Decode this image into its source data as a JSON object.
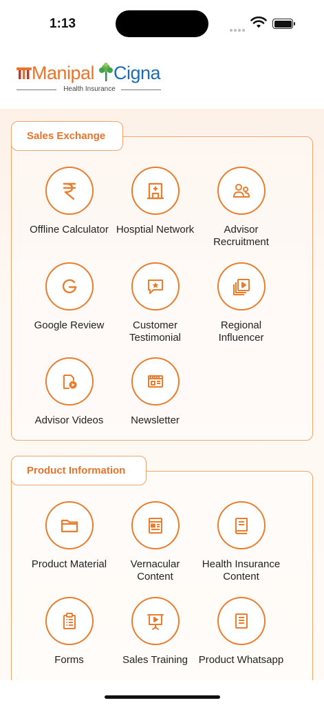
{
  "status_bar": {
    "time": "1:13"
  },
  "header": {
    "brand_part1": "Manipal",
    "brand_part2": "Cigna",
    "tagline": "Health Insurance"
  },
  "colors": {
    "accent": "#E8742B",
    "brand_blue": "#1F6BB0",
    "border": "#F0A56A"
  },
  "sections": [
    {
      "title": "Sales Exchange",
      "items": [
        {
          "label": "Offline Calculator",
          "icon": "rupee-icon"
        },
        {
          "label": "Hosptial Network",
          "icon": "hospital-icon"
        },
        {
          "label": "Advisor Recruitment",
          "icon": "users-icon"
        },
        {
          "label": "Google Review",
          "icon": "google-icon"
        },
        {
          "label": "Customer Testimonial",
          "icon": "star-message-icon"
        },
        {
          "label": "Regional Influencer",
          "icon": "video-library-icon"
        },
        {
          "label": "Advisor Videos",
          "icon": "video-file-icon"
        },
        {
          "label": "Newsletter",
          "icon": "newsletter-icon"
        }
      ]
    },
    {
      "title": "Product Information",
      "items": [
        {
          "label": "Product Material",
          "icon": "folder-icon"
        },
        {
          "label": "Vernacular Content",
          "icon": "document-icon"
        },
        {
          "label": "Health Insurance Content",
          "icon": "book-icon"
        },
        {
          "label": "Forms",
          "icon": "clipboard-icon"
        },
        {
          "label": "Sales Training",
          "icon": "presentation-icon"
        },
        {
          "label": "Product Whatsapp",
          "icon": "list-document-icon"
        }
      ]
    }
  ]
}
